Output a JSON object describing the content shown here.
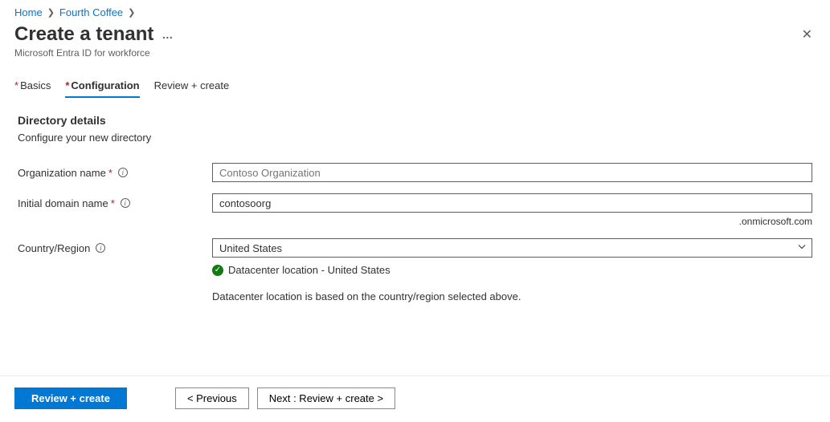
{
  "breadcrumb": {
    "home": "Home",
    "parent": "Fourth Coffee"
  },
  "header": {
    "title": "Create a tenant",
    "subtitle": "Microsoft Entra ID for workforce"
  },
  "tabs": {
    "basics": "Basics",
    "configuration": "Configuration",
    "review": "Review + create"
  },
  "section": {
    "title": "Directory details",
    "desc": "Configure your new directory"
  },
  "form": {
    "org_label": "Organization name",
    "org_placeholder": "Contoso Organization",
    "org_value": "",
    "domain_label": "Initial domain name",
    "domain_value": "contosoorg",
    "domain_suffix": ".onmicrosoft.com",
    "region_label": "Country/Region",
    "region_value": "United States"
  },
  "status": {
    "datacenter": "Datacenter location - United States",
    "note": "Datacenter location is based on the country/region selected above."
  },
  "footer": {
    "review": "Review + create",
    "previous": "< Previous",
    "next": "Next : Review + create >"
  }
}
